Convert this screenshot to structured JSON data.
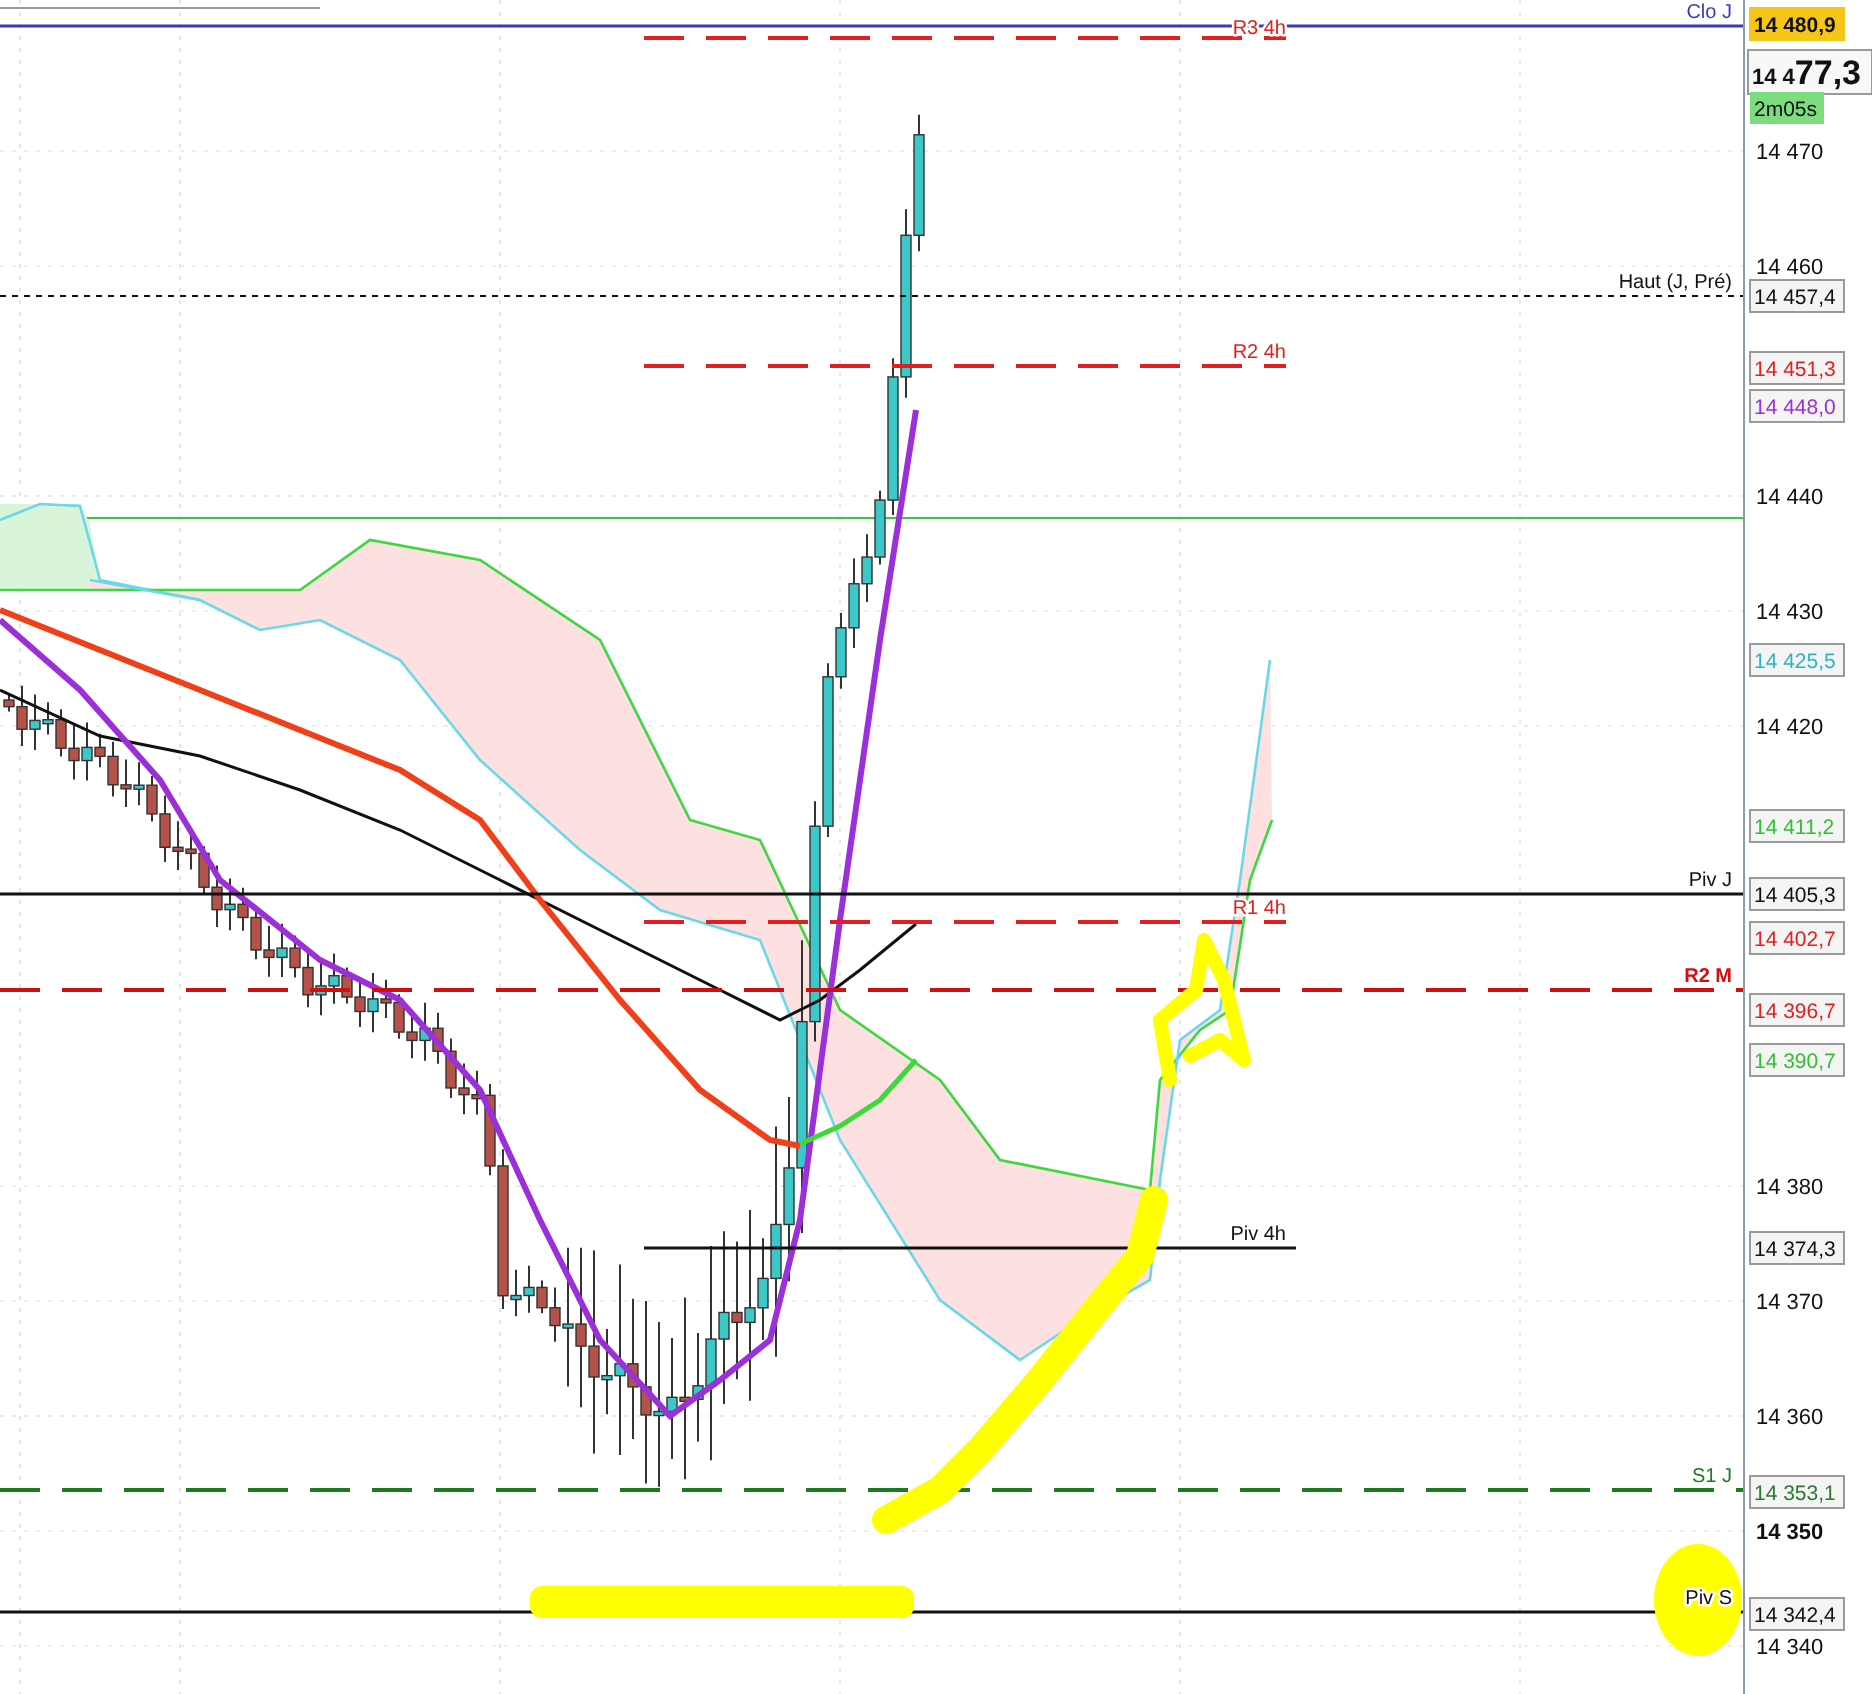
{
  "chart": {
    "levels": [
      {
        "label": "Clo J",
        "color": "#3b3bb5",
        "kind": "solid",
        "bold": false
      },
      {
        "label": "R3 4h",
        "color": "#e02020",
        "kind": "dashed",
        "bold": false
      },
      {
        "label": "Haut (J, Pré)",
        "color": "#111111",
        "kind": "dotted",
        "bold": false
      },
      {
        "label": "R2 4h",
        "color": "#e02020",
        "kind": "dashed",
        "bold": false
      },
      {
        "label": "Piv J",
        "color": "#111111",
        "kind": "solid",
        "bold": false
      },
      {
        "label": "R1 4h",
        "color": "#e02020",
        "kind": "dashed",
        "bold": false
      },
      {
        "label": "R2 M",
        "color": "#d01010",
        "kind": "dashed",
        "bold": true
      },
      {
        "label": "Piv 4h",
        "color": "#111111",
        "kind": "solid",
        "bold": false
      },
      {
        "label": "S1 J",
        "color": "#1e7a1e",
        "kind": "dashed",
        "bold": false
      },
      {
        "label": "Piv S",
        "color": "#111111",
        "kind": "solid",
        "bold": false
      }
    ],
    "price_axis": {
      "ticks": [
        {
          "label": "14 470",
          "bold": false
        },
        {
          "label": "14 460",
          "bold": false
        },
        {
          "label": "14 440",
          "bold": false
        },
        {
          "label": "14 430",
          "bold": false
        },
        {
          "label": "14 420",
          "bold": false
        },
        {
          "label": "14 380",
          "bold": false
        },
        {
          "label": "14 370",
          "bold": false
        },
        {
          "label": "14 360",
          "bold": false
        },
        {
          "label": "14 350",
          "bold": true
        },
        {
          "label": "14 340",
          "bold": false
        }
      ]
    },
    "price_tags": [
      {
        "label": "14 480,9",
        "color": "#111111",
        "kind": "highlight"
      },
      {
        "label": "14 457,4",
        "color": "#111111",
        "kind": "boxed"
      },
      {
        "label": "14 451,3",
        "color": "#e02020",
        "kind": "boxed"
      },
      {
        "label": "14 448,0",
        "color": "#9b30d9",
        "kind": "boxed"
      },
      {
        "label": "14 425,5",
        "color": "#2bb5c0",
        "kind": "boxed"
      },
      {
        "label": "14 411,2",
        "color": "#30c030",
        "kind": "boxed"
      },
      {
        "label": "14 405,3",
        "color": "#111111",
        "kind": "boxed"
      },
      {
        "label": "14 402,7",
        "color": "#e02020",
        "kind": "boxed"
      },
      {
        "label": "14 396,7",
        "color": "#e02020",
        "kind": "boxed"
      },
      {
        "label": "14 390,7",
        "color": "#30c030",
        "kind": "boxed"
      },
      {
        "label": "14 374,3",
        "color": "#111111",
        "kind": "boxed"
      },
      {
        "label": "14 353,1",
        "color": "#2a7a2a",
        "kind": "boxed"
      },
      {
        "label": "14 342,4",
        "color": "#111111",
        "kind": "boxed"
      }
    ],
    "last_price": {
      "prefix": "14 4",
      "value": "77,3",
      "countdown": "2m05s"
    }
  }
}
